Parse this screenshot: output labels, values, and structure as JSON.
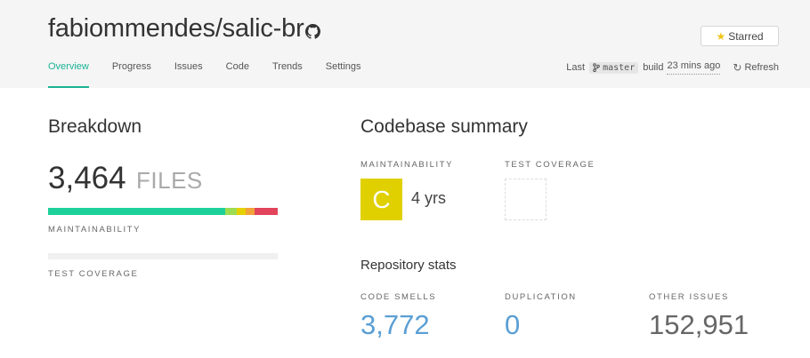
{
  "header": {
    "repo_title": "fabiommendes/salic-br",
    "github_icon": "github-icon",
    "star_button": {
      "icon": "star-icon",
      "label": "Starred"
    },
    "tabs": [
      {
        "label": "Overview",
        "active": true
      },
      {
        "label": "Progress",
        "active": false
      },
      {
        "label": "Issues",
        "active": false
      },
      {
        "label": "Code",
        "active": false
      },
      {
        "label": "Trends",
        "active": false
      },
      {
        "label": "Settings",
        "active": false
      }
    ],
    "build": {
      "prefix": "Last",
      "branch_icon": "git-branch-icon",
      "branch": "master",
      "label": "build",
      "ago": "23 mins ago",
      "refresh_icon": "refresh-icon",
      "refresh_label": "Refresh"
    }
  },
  "breakdown": {
    "title": "Breakdown",
    "files_count": "3,464",
    "files_unit": "FILES",
    "maintainability_label": "MAINTAINABILITY",
    "maintainability_distribution": [
      {
        "grade": "A",
        "fraction": 0.77,
        "color": "#1dd09a"
      },
      {
        "grade": "B",
        "fraction": 0.05,
        "color": "#9edd52"
      },
      {
        "grade": "C",
        "fraction": 0.04,
        "color": "#e6d100"
      },
      {
        "grade": "D",
        "fraction": 0.04,
        "color": "#f2a23a"
      },
      {
        "grade": "F",
        "fraction": 0.1,
        "color": "#e2445c"
      }
    ],
    "test_coverage_label": "TEST COVERAGE"
  },
  "summary": {
    "title": "Codebase summary",
    "maintainability_label": "MAINTAINABILITY",
    "grade": "C",
    "grade_color": "#e0d000",
    "years": "4 yrs",
    "test_coverage_label": "TEST COVERAGE",
    "stats_title": "Repository stats",
    "stats": [
      {
        "label": "CODE SMELLS",
        "value": "3,772",
        "color": "#5a9fd4"
      },
      {
        "label": "DUPLICATION",
        "value": "0",
        "color": "#5a9fd4"
      },
      {
        "label": "OTHER ISSUES",
        "value": "152,951",
        "color": "#666666"
      }
    ]
  }
}
